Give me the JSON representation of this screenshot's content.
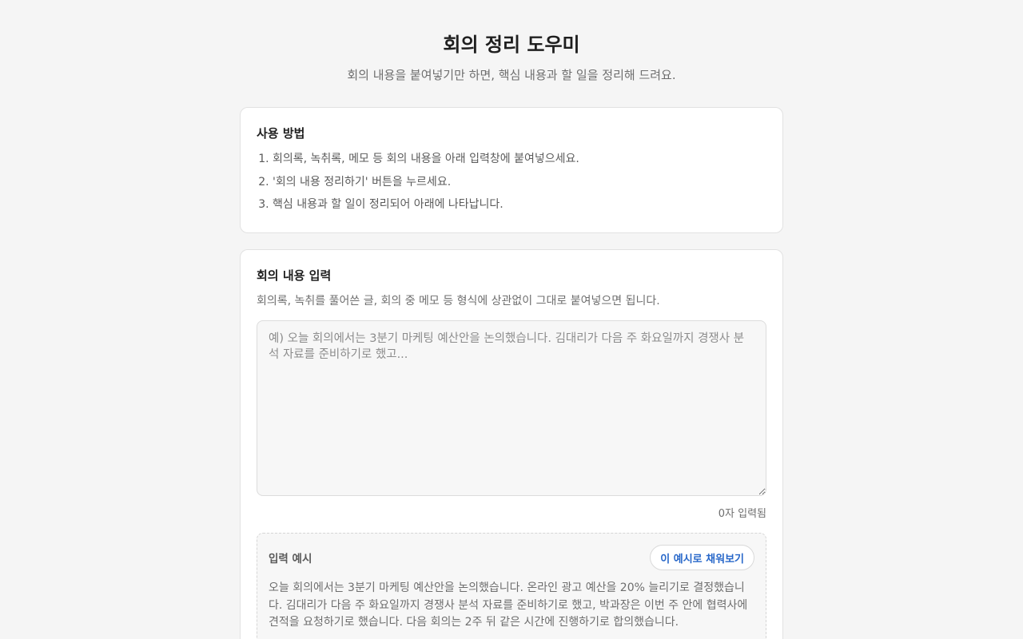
{
  "header": {
    "title": "회의 정리 도우미",
    "subtitle": "회의 내용을 붙여넣기만 하면, 핵심 내용과 할 일을 정리해 드려요."
  },
  "howto": {
    "title": "사용 방법",
    "steps": [
      "회의록, 녹취록, 메모 등 회의 내용을 아래 입력창에 붙여넣으세요.",
      "'회의 내용 정리하기' 버튼을 누르세요.",
      "핵심 내용과 할 일이 정리되어 아래에 나타납니다."
    ]
  },
  "input": {
    "title": "회의 내용 입력",
    "description": "회의록, 녹취를 풀어쓴 글, 회의 중 메모 등 형식에 상관없이 그대로 붙여넣으면 됩니다.",
    "placeholder": "예) 오늘 회의에서는 3분기 마케팅 예산안을 논의했습니다. 김대리가 다음 주 화요일까지 경쟁사 분석 자료를 준비하기로 했고...",
    "value": "",
    "char_count": "0자 입력됨"
  },
  "example": {
    "label": "입력 예시",
    "fill_button": "이 예시로 채워보기",
    "text": "오늘 회의에서는 3분기 마케팅 예산안을 논의했습니다. 온라인 광고 예산을 20% 늘리기로 결정했습니다. 김대리가 다음 주 화요일까지 경쟁사 분석 자료를 준비하기로 했고, 박과장은 이번 주 안에 협력사에 견적을 요청하기로 했습니다. 다음 회의는 2주 뒤 같은 시간에 진행하기로 합의했습니다."
  }
}
